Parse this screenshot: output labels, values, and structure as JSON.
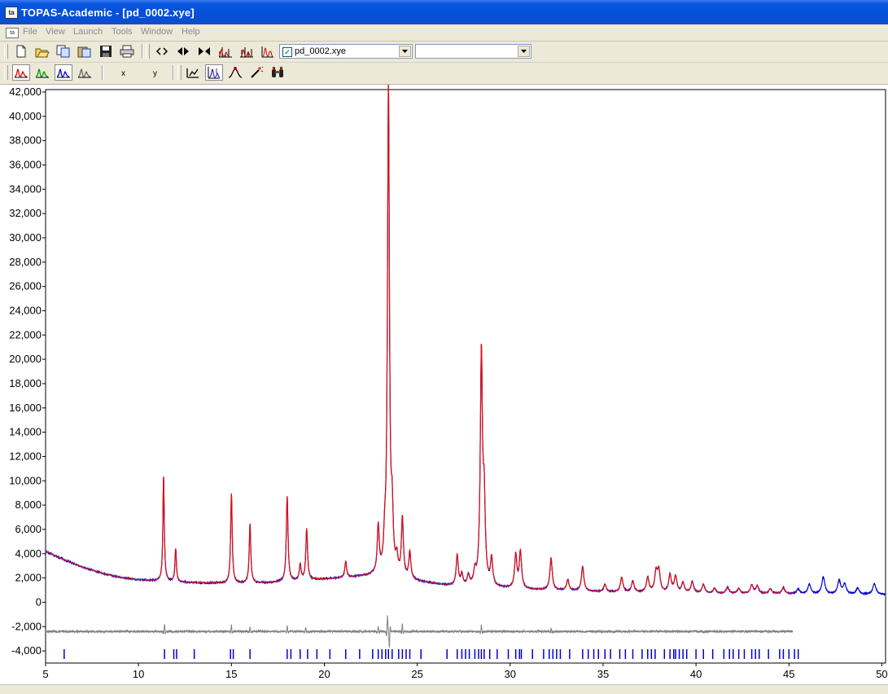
{
  "window": {
    "title": "TOPAS-Academic - [pd_0002.xye]"
  },
  "menu": {
    "icon": "mdi-document-icon",
    "items": [
      {
        "label": "File"
      },
      {
        "label": "View"
      },
      {
        "label": "Launch"
      },
      {
        "label": "Tools"
      },
      {
        "label": "Window"
      },
      {
        "label": "Help"
      }
    ]
  },
  "toolbar": {
    "file_combo": {
      "value": "pd_0002.xye",
      "checked": true
    },
    "second_combo": {
      "value": ""
    },
    "x_label": "x",
    "y_label": "y",
    "icons_row1": [
      "new-file-icon",
      "open-folder-icon",
      "copy-icon",
      "paste-icon",
      "save-icon",
      "print-icon",
      "expand-horizontal-icon",
      "shift-left-right-icon",
      "shrink-horizontal-icon",
      "peaks-icon",
      "peaks-add-icon",
      "peaks-select-icon"
    ],
    "icons_row2": [
      "red-pattern-icon",
      "green-pattern-icon",
      "blue-pattern-icon",
      "grey-pattern-icon",
      "scale-icon",
      "peak-cursor-icon",
      "peak-marker-icon",
      "magic-wand-icon",
      "binoculars-icon"
    ]
  },
  "colors": {
    "observed": "#0000c8",
    "calculated": "#e01010",
    "difference": "#808080",
    "reflections": "#0000d0"
  },
  "chart_data": {
    "type": "line",
    "title": "",
    "xlabel": "",
    "ylabel": "",
    "xlim": [
      5,
      50.2
    ],
    "ylim": [
      -5000,
      42200
    ],
    "grid": false,
    "x_ticks": [
      5,
      10,
      15,
      20,
      25,
      30,
      35,
      40,
      45,
      50
    ],
    "y_ticks": [
      42000,
      40000,
      38000,
      36000,
      34000,
      32000,
      30000,
      28000,
      26000,
      24000,
      22000,
      20000,
      18000,
      16000,
      14000,
      12000,
      10000,
      8000,
      6000,
      4000,
      2000,
      0,
      -2000,
      -4000
    ],
    "y_tick_labels": [
      "42,000",
      "40,000",
      "38,000",
      "36,000",
      "34,000",
      "32,000",
      "30,000",
      "28,000",
      "26,000",
      "24,000",
      "22,000",
      "20,000",
      "18,000",
      "16,000",
      "14,000",
      "12,000",
      "10,000",
      "8,000",
      "6,000",
      "4,000",
      "2,000",
      "0",
      "-2,000",
      "-4,000"
    ],
    "background_points": [
      [
        5,
        4200
      ],
      [
        6,
        3500
      ],
      [
        7,
        2900
      ],
      [
        8,
        2400
      ],
      [
        9,
        2050
      ],
      [
        10,
        1850
      ],
      [
        11,
        1750
      ],
      [
        13,
        1600
      ],
      [
        15,
        1550
      ],
      [
        17,
        1600
      ],
      [
        19,
        1800
      ],
      [
        21,
        2000
      ],
      [
        23,
        2200
      ],
      [
        25,
        1700
      ],
      [
        27,
        1300
      ],
      [
        29,
        1200
      ],
      [
        31,
        1050
      ],
      [
        33,
        950
      ],
      [
        35,
        850
      ],
      [
        37,
        800
      ],
      [
        39,
        760
      ],
      [
        41,
        720
      ],
      [
        43,
        700
      ],
      [
        45,
        680
      ],
      [
        47,
        650
      ],
      [
        50.2,
        630
      ]
    ],
    "peaks": [
      {
        "x": 11.35,
        "h": 8600
      },
      {
        "x": 12.0,
        "h": 2700
      },
      {
        "x": 15.0,
        "h": 7400
      },
      {
        "x": 16.0,
        "h": 4800
      },
      {
        "x": 18.0,
        "h": 7000
      },
      {
        "x": 18.7,
        "h": 1300
      },
      {
        "x": 19.05,
        "h": 4200
      },
      {
        "x": 21.15,
        "h": 1300
      },
      {
        "x": 22.9,
        "h": 3800
      },
      {
        "x": 23.25,
        "h": 2000
      },
      {
        "x": 23.45,
        "h": 40000
      },
      {
        "x": 23.65,
        "h": 4300
      },
      {
        "x": 23.9,
        "h": 1300
      },
      {
        "x": 24.2,
        "h": 4800
      },
      {
        "x": 24.6,
        "h": 2200
      },
      {
        "x": 27.15,
        "h": 2500
      },
      {
        "x": 27.4,
        "h": 900
      },
      {
        "x": 27.75,
        "h": 800
      },
      {
        "x": 28.1,
        "h": 1000
      },
      {
        "x": 28.45,
        "h": 18800
      },
      {
        "x": 28.6,
        "h": 6300
      },
      {
        "x": 29.0,
        "h": 2200
      },
      {
        "x": 30.3,
        "h": 2700
      },
      {
        "x": 30.55,
        "h": 3000
      },
      {
        "x": 32.2,
        "h": 2600
      },
      {
        "x": 33.1,
        "h": 900
      },
      {
        "x": 33.9,
        "h": 2000
      },
      {
        "x": 35.1,
        "h": 600
      },
      {
        "x": 36.0,
        "h": 1200
      },
      {
        "x": 36.6,
        "h": 900
      },
      {
        "x": 37.4,
        "h": 1200
      },
      {
        "x": 37.85,
        "h": 1600
      },
      {
        "x": 38.0,
        "h": 1700
      },
      {
        "x": 38.6,
        "h": 1400
      },
      {
        "x": 38.9,
        "h": 1300
      },
      {
        "x": 39.3,
        "h": 800
      },
      {
        "x": 39.8,
        "h": 900
      },
      {
        "x": 40.4,
        "h": 700
      },
      {
        "x": 41.0,
        "h": 400
      },
      {
        "x": 41.7,
        "h": 500
      },
      {
        "x": 42.3,
        "h": 400
      },
      {
        "x": 43.0,
        "h": 700
      },
      {
        "x": 43.3,
        "h": 600
      },
      {
        "x": 44.0,
        "h": 400
      },
      {
        "x": 44.7,
        "h": 500
      },
      {
        "x": 45.5,
        "h": 400
      },
      {
        "x": 46.1,
        "h": 800
      },
      {
        "x": 46.85,
        "h": 1400
      },
      {
        "x": 47.7,
        "h": 1100
      },
      {
        "x": 48.0,
        "h": 800
      },
      {
        "x": 48.7,
        "h": 500
      },
      {
        "x": 49.6,
        "h": 900
      }
    ],
    "calc_xmax": 45.2,
    "diff_offset": -2400,
    "diff_xmax": 45.2,
    "diff_features": [
      {
        "x": 11.4,
        "a": 600
      },
      {
        "x": 15.0,
        "a": 500
      },
      {
        "x": 16.0,
        "a": 300
      },
      {
        "x": 18.0,
        "a": 500
      },
      {
        "x": 19.0,
        "a": 300
      },
      {
        "x": 22.9,
        "a": 400
      },
      {
        "x": 23.4,
        "a": 1300
      },
      {
        "x": 23.5,
        "a": -1400
      },
      {
        "x": 24.2,
        "a": 600
      },
      {
        "x": 28.45,
        "a": 500
      },
      {
        "x": 32.2,
        "a": 250
      }
    ],
    "reflections": [
      6.0,
      11.4,
      11.9,
      12.05,
      13.0,
      14.95,
      15.1,
      16.0,
      18.0,
      18.2,
      18.7,
      19.1,
      19.6,
      20.3,
      21.15,
      21.9,
      22.6,
      22.9,
      23.1,
      23.3,
      23.45,
      23.65,
      24.0,
      24.2,
      24.4,
      24.6,
      25.2,
      26.6,
      27.15,
      27.4,
      27.6,
      27.8,
      28.1,
      28.3,
      28.45,
      28.6,
      28.9,
      29.3,
      29.9,
      30.3,
      30.5,
      30.6,
      31.2,
      31.8,
      32.1,
      32.3,
      32.5,
      32.7,
      33.2,
      33.9,
      34.2,
      34.5,
      34.75,
      35.1,
      35.4,
      35.9,
      36.2,
      36.6,
      37.1,
      37.4,
      37.6,
      37.8,
      38.3,
      38.6,
      38.8,
      38.9,
      39.1,
      39.3,
      39.5,
      40.0,
      40.4,
      40.9,
      41.5,
      41.8,
      42.0,
      42.3,
      42.6,
      43.0,
      43.2,
      43.4,
      43.9,
      44.5,
      44.7,
      45.0,
      45.3,
      45.5
    ]
  }
}
